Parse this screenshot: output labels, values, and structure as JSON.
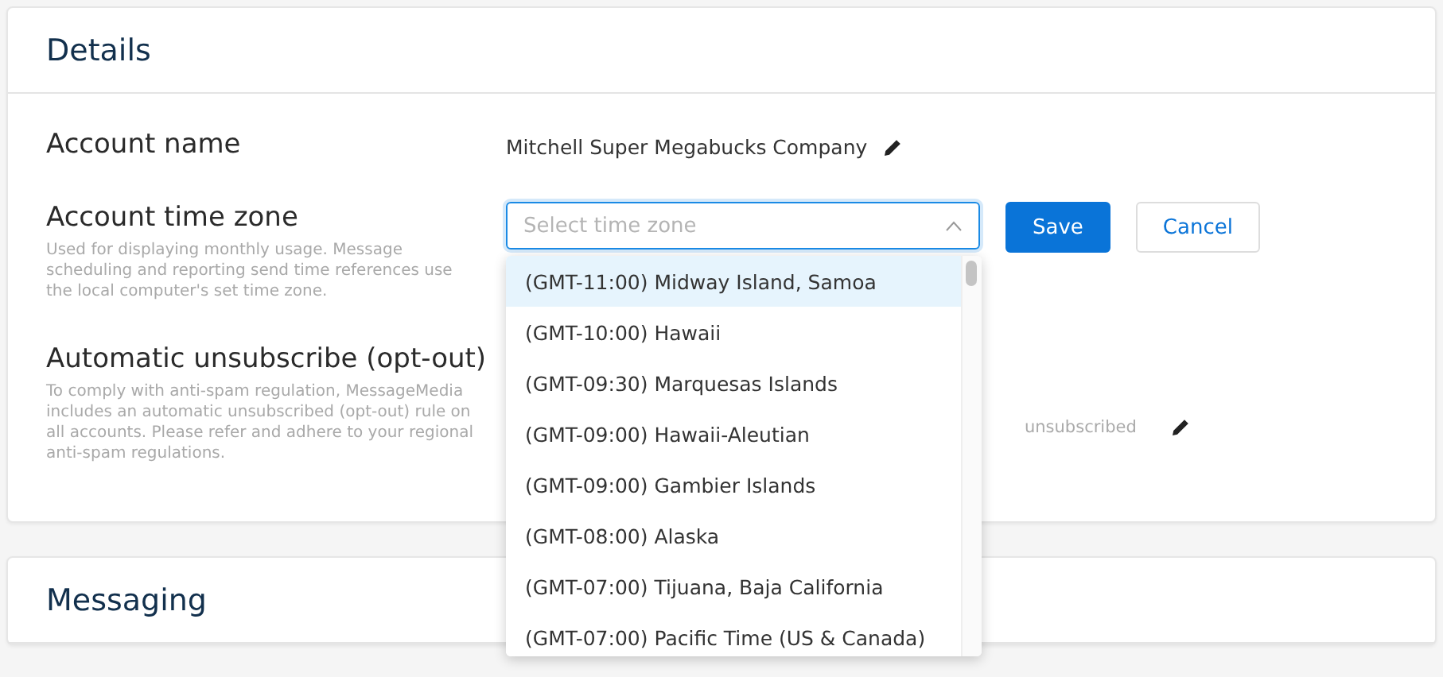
{
  "details": {
    "title": "Details",
    "account_name": {
      "label": "Account name",
      "value": "Mitchell Super Megabucks Company"
    },
    "time_zone": {
      "label": "Account time zone",
      "description": "Used for displaying monthly usage. Message scheduling and reporting send time references use the local computer's set time zone.",
      "placeholder": "Select time zone",
      "expanded": true,
      "save": "Save",
      "cancel": "Cancel",
      "options": [
        {
          "label": "(GMT-11:00) Midway Island, Samoa",
          "selected": true
        },
        {
          "label": "(GMT-10:00) Hawaii",
          "selected": false
        },
        {
          "label": "(GMT-09:30) Marquesas Islands",
          "selected": false
        },
        {
          "label": "(GMT-09:00) Hawaii-Aleutian",
          "selected": false
        },
        {
          "label": "(GMT-09:00) Gambier Islands",
          "selected": false
        },
        {
          "label": "(GMT-08:00) Alaska",
          "selected": false
        },
        {
          "label": "(GMT-07:00) Tijuana, Baja California",
          "selected": false
        },
        {
          "label": "(GMT-07:00) Pacific Time (US & Canada)",
          "selected": false
        }
      ]
    },
    "opt_out": {
      "label": "Automatic unsubscribe (opt-out)",
      "description": "To comply with anti-spam regulation, MessageMedia includes an automatic unsubscribed (opt-out) rule on all accounts. Please refer and adhere to your regional anti-spam regulations.",
      "value": "unsubscribed"
    }
  },
  "messaging": {
    "title": "Messaging"
  }
}
